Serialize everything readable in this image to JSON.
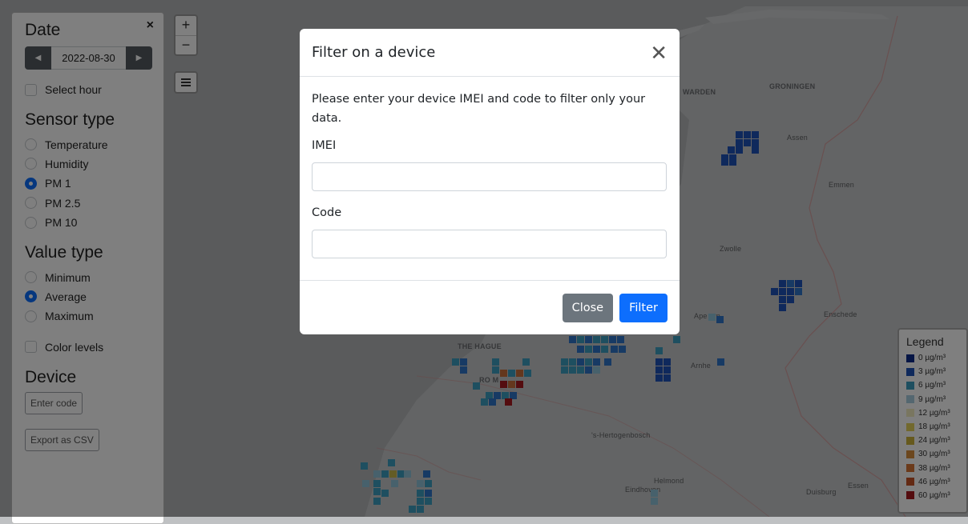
{
  "sidebar": {
    "date_heading": "Date",
    "date_value": "2022-08-30",
    "select_hour": "Select hour",
    "sensor_heading": "Sensor type",
    "sensor_options": [
      "Temperature",
      "Humidity",
      "PM 1",
      "PM 2.5",
      "PM 10"
    ],
    "sensor_selected": "PM 1",
    "value_heading": "Value type",
    "value_options": [
      "Minimum",
      "Average",
      "Maximum"
    ],
    "value_selected": "Average",
    "color_levels": "Color levels",
    "device_heading": "Device",
    "enter_code": "Enter code",
    "export_csv": "Export as CSV",
    "close_glyph": "×"
  },
  "map": {
    "zoom_in": "+",
    "zoom_out": "−",
    "labels": {
      "warden": "WARDEN",
      "groningen": "GRONINGEN",
      "assen": "Assen",
      "emmen": "Emmen",
      "zwolle": "Zwolle",
      "apeldoorn": "Ape    orn",
      "enschede": "Enschede",
      "the_hague": "THE HAGUE",
      "rotterdam": "RO         M",
      "arnhem": "Arnhe",
      "hertogenbosch": "'s-Hertogenbosch",
      "helmond": "Helmond",
      "eindhoven": "Eindhoven",
      "duisburg": "Duisburg",
      "essen": "Essen"
    },
    "cell_colors": {
      "dblue": "#1f52b8",
      "mblue": "#2e74c9",
      "teal": "#3d9ec1",
      "lteal": "#8ec3d8",
      "orange": "#c96f3a",
      "red": "#a8181e",
      "yellow": "#c9b84a"
    }
  },
  "legend": {
    "title": "Legend",
    "items": [
      {
        "label": "0 µg/m³",
        "color": "#0a2a8a"
      },
      {
        "label": "3 µg/m³",
        "color": "#1f52b8"
      },
      {
        "label": "6 µg/m³",
        "color": "#3d9ec1"
      },
      {
        "label": "9 µg/m³",
        "color": "#a9cfe0"
      },
      {
        "label": "12 µg/m³",
        "color": "#f2ecc0"
      },
      {
        "label": "18 µg/m³",
        "color": "#e5d35a"
      },
      {
        "label": "24 µg/m³",
        "color": "#cdb33a"
      },
      {
        "label": "30 µg/m³",
        "color": "#d98f3d"
      },
      {
        "label": "38 µg/m³",
        "color": "#d67534"
      },
      {
        "label": "46 µg/m³",
        "color": "#c65326"
      },
      {
        "label": "60 µg/m³",
        "color": "#a8181e"
      }
    ]
  },
  "modal": {
    "title": "Filter on a device",
    "description": "Please enter your device IMEI and code to filter only your data.",
    "imei_label": "IMEI",
    "imei_value": "",
    "code_label": "Code",
    "code_value": "",
    "close_label": "Close",
    "filter_label": "Filter",
    "close_glyph": "✕"
  }
}
